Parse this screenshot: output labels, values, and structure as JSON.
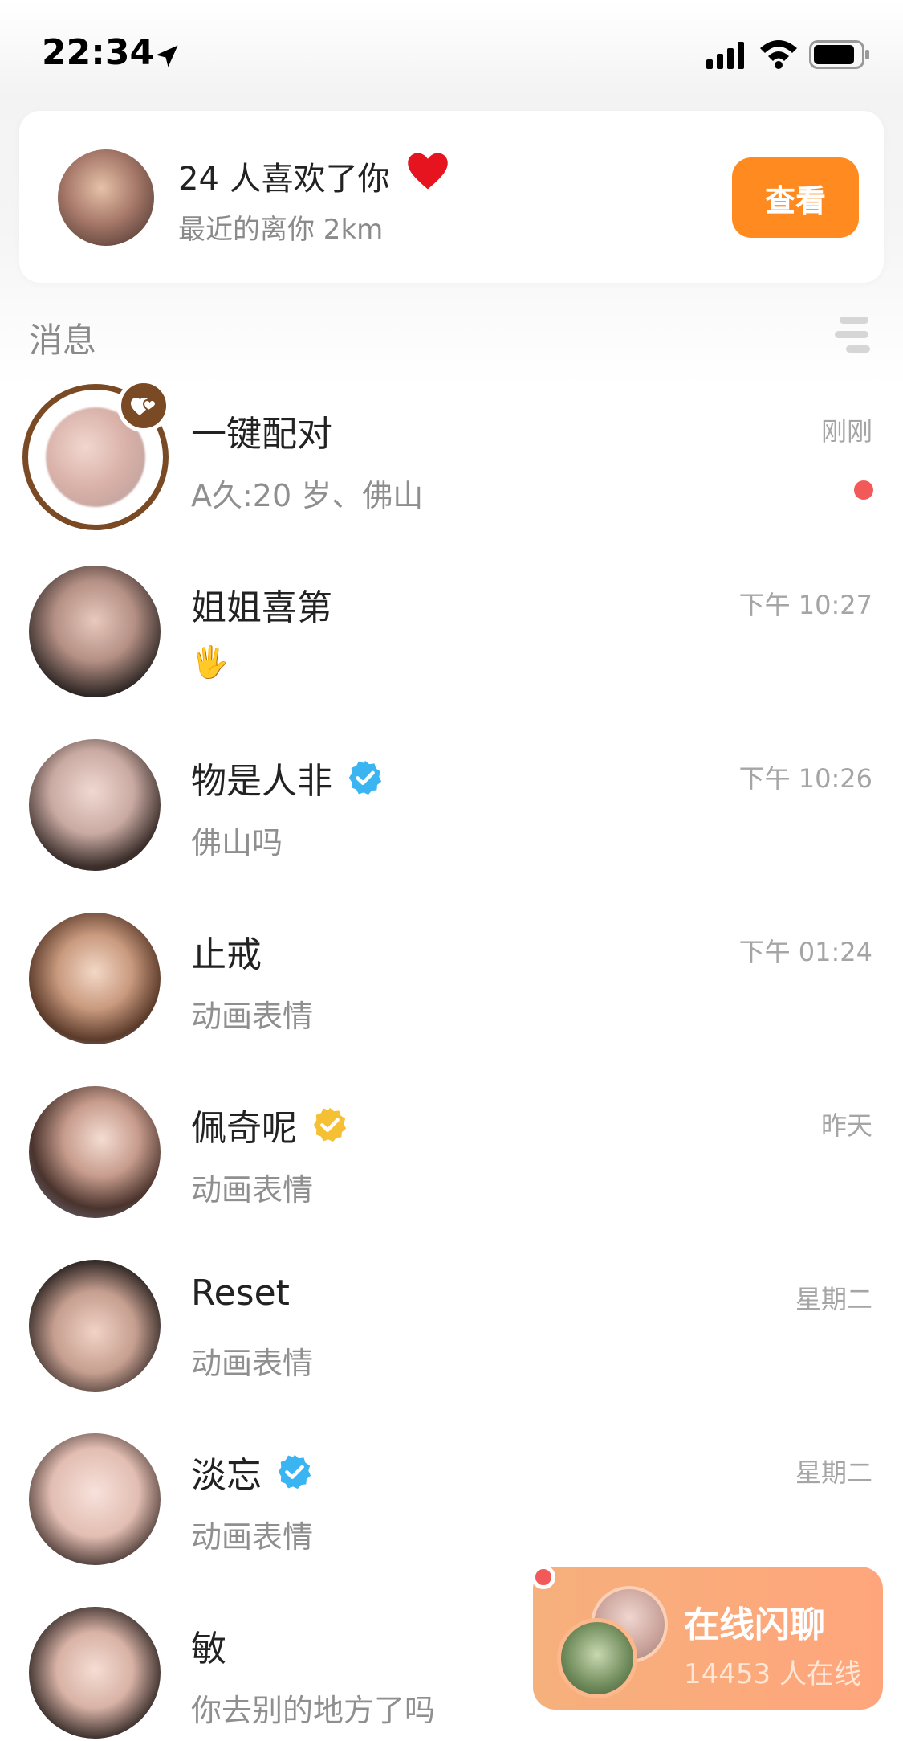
{
  "status_bar": {
    "time": "22:34"
  },
  "likes_card": {
    "title": "24 人喜欢了你",
    "subtitle": "最近的离你 2km",
    "button_label": "查看"
  },
  "section": {
    "title": "消息"
  },
  "messages": [
    {
      "name": "一键配对",
      "time": "刚刚",
      "preview": "A久:20 岁、佛山",
      "unread": true,
      "type": "pair"
    },
    {
      "name": "姐姐喜第",
      "time": "下午 10:27",
      "preview": "🖐",
      "verified": null
    },
    {
      "name": "物是人非",
      "time": "下午 10:26",
      "preview": "佛山吗",
      "verified": "blue"
    },
    {
      "name": "止戒",
      "time": "下午 01:24",
      "preview": "动画表情",
      "verified": null
    },
    {
      "name": "佩奇呢",
      "time": "昨天",
      "preview": "动画表情",
      "verified": "gold"
    },
    {
      "name": "Reset",
      "time": "星期二",
      "preview": "动画表情",
      "verified": null
    },
    {
      "name": "淡忘",
      "time": "星期二",
      "preview": "动画表情",
      "verified": "blue"
    },
    {
      "name": "敏",
      "time": "",
      "preview": "你去别的地方了吗",
      "verified": null
    }
  ],
  "online_chat": {
    "title": "在线闪聊",
    "subtitle": "14453 人在线"
  },
  "colors": {
    "accent_orange": "#ff8a1f",
    "verify_blue": "#3bb4f2",
    "verify_gold": "#f5c033",
    "unread_red": "#f25a5a",
    "pair_brown": "#7a4a25"
  }
}
